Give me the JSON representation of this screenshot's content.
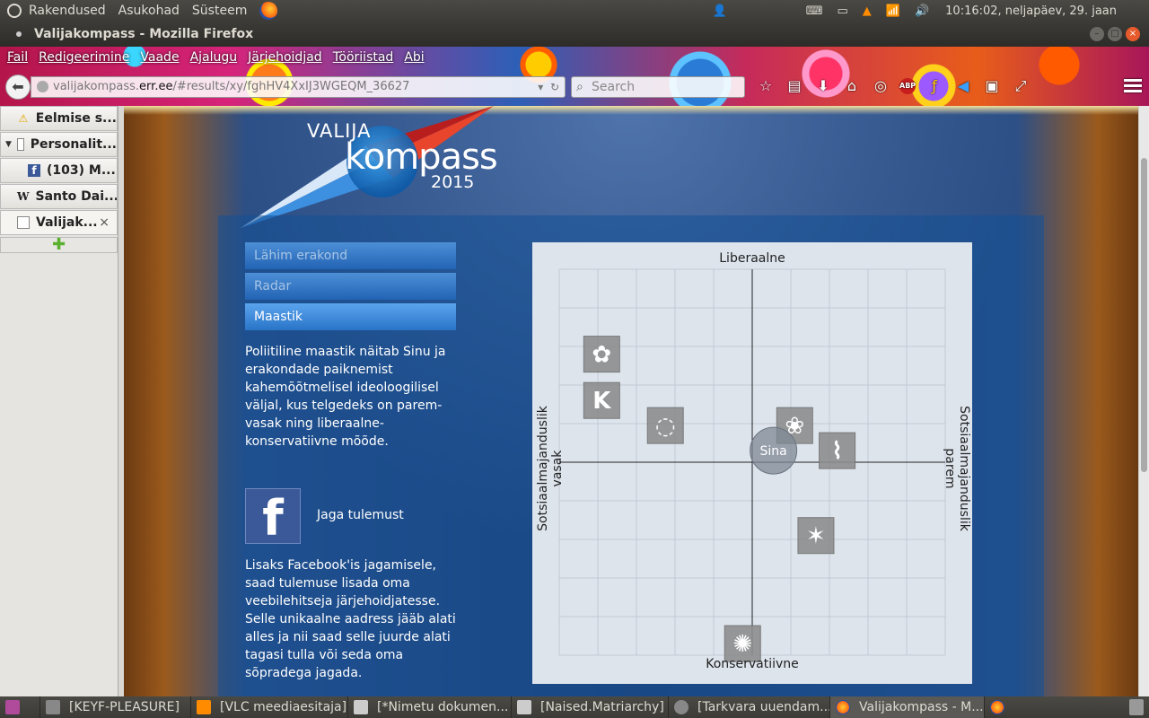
{
  "top_panel": {
    "menus": [
      "Rakendused",
      "Asukohad",
      "Süsteem"
    ],
    "clock": "10:16:02, neljapäev, 29. jaan"
  },
  "window": {
    "title": "Valijakompass - Mozilla Firefox"
  },
  "menubar": [
    "Fail",
    "Redigeerimine",
    "Vaade",
    "Ajalugu",
    "Järjehoidjad",
    "Tööriistad",
    "Abi"
  ],
  "urlbar": {
    "prefix": "valijakompass.",
    "host": "err.ee",
    "path": "/#results/xy/fghHV4XxIJ3WGEQM_36627"
  },
  "search": {
    "placeholder": "Search"
  },
  "sidebar_tabs": [
    {
      "label": "Eelmise s...",
      "icon": "warning-icon"
    },
    {
      "label": "Personalit...",
      "icon": "page-icon"
    },
    {
      "label": "(103) M...",
      "icon": "facebook-icon"
    },
    {
      "label": "Santo Dai...",
      "icon": "wikipedia-icon"
    },
    {
      "label": "Valijak...",
      "icon": "page-icon"
    }
  ],
  "logo": {
    "line1": "VALIJA",
    "line2": "kompass",
    "year": "2015"
  },
  "nav": {
    "items": [
      "Lähim erakond",
      "Radar",
      "Maastik"
    ],
    "active": "Maastik"
  },
  "description": "Poliitiline maastik näitab Sinu ja erakondade paiknemist kahemõõtmelisel ideoloogilisel väljal, kus telgedeks on parem-vasak ning liberaalne-konservatiivne mõõde.",
  "share": {
    "fb_glyph": "f",
    "label": "Jaga tulemust",
    "text": "Lisaks Facebook'is jagamisele, saad tulemuse lisada oma veebilehitseja järjehoidjatesse. Selle unikaalne aadress jääb alati alles ja nii saad selle juurde alati tagasi tulla või seda oma sõpradega jagada."
  },
  "chart_data": {
    "type": "scatter",
    "axes": {
      "top": "Liberaalne",
      "bottom": "Konservatiivne",
      "left": "Sotsiaalmajanduslik vasak",
      "right": "Sotsiaalmajanduslik parem"
    },
    "xlim": [
      -5,
      5
    ],
    "ylim": [
      -5,
      5
    ],
    "grid": true,
    "points": [
      {
        "icon": "rose-icon",
        "x": -3.9,
        "y": 2.8
      },
      {
        "icon": "k-logo-icon",
        "x": -3.9,
        "y": 1.6
      },
      {
        "icon": "spiral-icon",
        "x": -2.25,
        "y": 0.95
      },
      {
        "icon": "flower-icon",
        "x": 1.1,
        "y": 0.95
      },
      {
        "icon": "bird-icon",
        "x": 2.2,
        "y": 0.3
      },
      {
        "icon": "star-icon",
        "x": 1.65,
        "y": -1.9
      },
      {
        "icon": "cornflower-icon",
        "x": -0.25,
        "y": -4.7
      }
    ],
    "user": {
      "label": "Sina",
      "x": 0.55,
      "y": 0.3
    }
  },
  "taskbar": [
    {
      "label": "[KEYF-PLEASURE]"
    },
    {
      "label": "[VLC meediaesitaja]"
    },
    {
      "label": "[*Nimetu dokumen..."
    },
    {
      "label": "[Naised.Matriarchy]"
    },
    {
      "label": "[Tarkvara uuendam..."
    },
    {
      "label": "Valijakompass - M..."
    }
  ]
}
